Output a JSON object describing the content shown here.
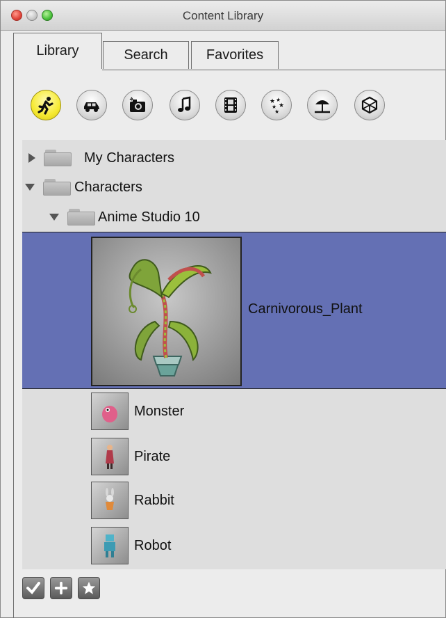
{
  "window": {
    "title": "Content Library"
  },
  "tabs": [
    {
      "label": "Library",
      "active": true
    },
    {
      "label": "Search",
      "active": false
    },
    {
      "label": "Favorites",
      "active": false
    }
  ],
  "categories": [
    {
      "icon": "running-figure-icon",
      "active": true
    },
    {
      "icon": "car-icon",
      "active": false
    },
    {
      "icon": "camera-icon",
      "active": false
    },
    {
      "icon": "music-note-icon",
      "active": false
    },
    {
      "icon": "film-icon",
      "active": false
    },
    {
      "icon": "stars-icon",
      "active": false
    },
    {
      "icon": "beach-umbrella-icon",
      "active": false
    },
    {
      "icon": "cube-icon",
      "active": false
    }
  ],
  "tree": {
    "folders": [
      {
        "label": "My Characters",
        "expanded": false
      },
      {
        "label": "Characters",
        "expanded": true
      },
      {
        "label": "Anime Studio 10",
        "expanded": true
      }
    ],
    "selected_item": {
      "label": "Carnivorous_Plant"
    },
    "items": [
      {
        "label": "Monster"
      },
      {
        "label": "Pirate"
      },
      {
        "label": "Rabbit"
      },
      {
        "label": "Robot"
      }
    ]
  },
  "toolbar": [
    {
      "icon": "checkmark-icon"
    },
    {
      "icon": "plus-icon"
    },
    {
      "icon": "star-icon"
    }
  ],
  "colors": {
    "selection": "#6470b4",
    "active_category": "#f6ea32"
  }
}
